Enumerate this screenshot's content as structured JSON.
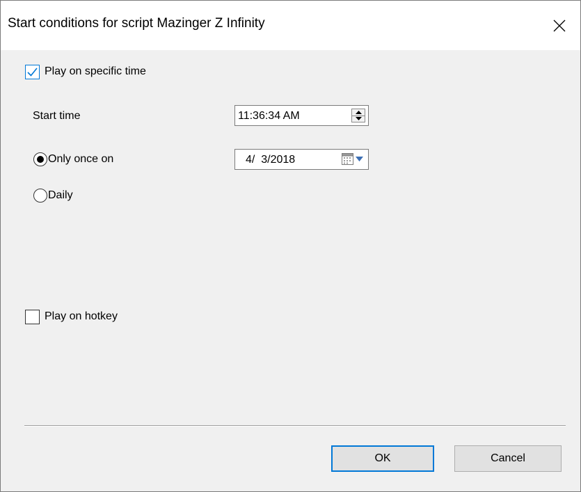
{
  "window": {
    "title": "Start conditions for script Mazinger Z Infinity"
  },
  "play_on_time": {
    "label": "Play on specific time",
    "checked": true
  },
  "start_time": {
    "label": "Start time",
    "value": "11:36:34 AM"
  },
  "schedule": {
    "only_once_label": "Only once on",
    "only_once_selected": true,
    "date_value": "4/  3/2018",
    "daily_label": "Daily",
    "daily_selected": false
  },
  "play_on_hotkey": {
    "label": "Play on hotkey",
    "checked": false
  },
  "buttons": {
    "ok_label": "OK",
    "cancel_label": "Cancel"
  },
  "colors": {
    "accent": "#0078d7",
    "dialog_background": "#f0f0f0",
    "titlebar_background": "#ffffff"
  },
  "icons": {
    "close": "close-icon",
    "checkmark": "checkmark-icon",
    "spin_up": "arrow-up-icon",
    "spin_down": "arrow-down-icon",
    "calendar": "calendar-icon",
    "dropdown": "chevron-down-icon"
  }
}
